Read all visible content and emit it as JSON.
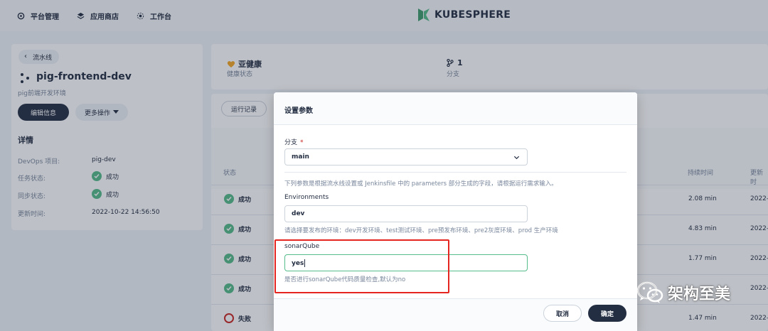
{
  "topnav": {
    "items": [
      {
        "label": "平台管理",
        "icon": "platform-icon"
      },
      {
        "label": "应用商店",
        "icon": "app-store-icon"
      },
      {
        "label": "工作台",
        "icon": "workbench-icon"
      }
    ],
    "logo_text": "KUBESPHERE"
  },
  "pipeline": {
    "back_label": "流水线",
    "name": "pig-frontend-dev",
    "description": "pig前端开发环境",
    "edit_label": "编辑信息",
    "more_label": "更多操作",
    "details_title": "详情",
    "details": [
      {
        "key": "DevOps 项目:",
        "value": "pig-dev",
        "check": false
      },
      {
        "key": "任务状态:",
        "value": "成功",
        "check": true
      },
      {
        "key": "同步状态:",
        "value": "成功",
        "check": true
      },
      {
        "key": "更新时间:",
        "value": "2022-10-22 14:56:50",
        "check": false
      }
    ]
  },
  "summary": {
    "health_value": "亚健康",
    "health_label": "健康状态",
    "branch_count": "1",
    "branch_label": "分支"
  },
  "runs": {
    "tab_label": "运行记录",
    "col_status": "状态",
    "col_duration": "持续时间",
    "col_updated": "更新时",
    "rows": [
      {
        "status": "成功",
        "duration": "2.08 min",
        "updated": "2022-"
      },
      {
        "status": "成功",
        "duration": "4.83 min",
        "updated": "2022-"
      },
      {
        "status": "成功",
        "duration": "1.77 min",
        "updated": "2022-"
      },
      {
        "status": "成功",
        "duration": "",
        "updated": "2022-"
      },
      {
        "status": "失败",
        "duration": "1.47 min",
        "updated": "2022-"
      }
    ]
  },
  "modal": {
    "title": "设置参数",
    "branch_label": "分支",
    "branch_required": "*",
    "branch_value": "main",
    "params_help": "下列参数是根据流水线设置或 Jenkinsfile 中的 parameters 部分生成的字段，请根据运行需求输入。",
    "env_label": "Environments",
    "env_value": "dev",
    "env_help": "请选择要发布的环境：dev开发环境、test测试环境、pre预发布环境、pre2灰度环境、prod 生产环境",
    "sonar_label": "sonarQube",
    "sonar_value": "yes",
    "sonar_help": "是否进行sonarQube代码质量检查,默认为no",
    "cancel_label": "取消",
    "ok_label": "确定"
  },
  "watermark": {
    "text": "架构至美"
  },
  "colors": {
    "success": "#55bc8a",
    "failure": "#ca2621",
    "primary_dark": "#242e42",
    "highlight_red": "#e5251f"
  }
}
